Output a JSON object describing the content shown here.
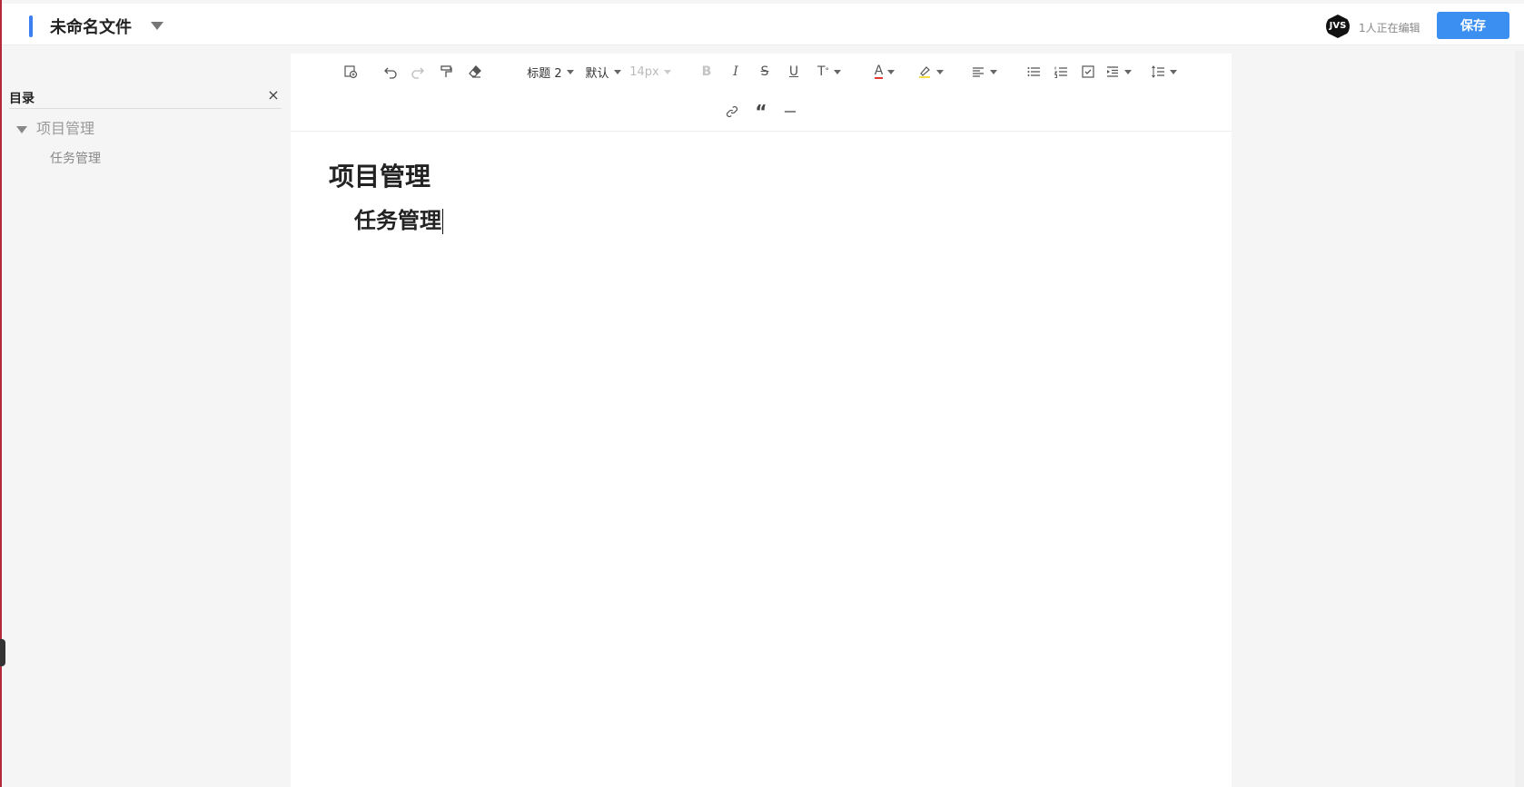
{
  "header": {
    "doc_title": "未命名文件",
    "avatar_text": "JVS",
    "editing_status": "1人正在编辑",
    "save_label": "保存"
  },
  "toc": {
    "title": "目录",
    "close_symbol": "×",
    "items": [
      {
        "label": "项目管理",
        "level": 1,
        "expanded": true
      },
      {
        "label": "任务管理",
        "level": 2
      }
    ]
  },
  "toolbar": {
    "heading_select": "标题 2",
    "font_select": "默认",
    "size_select": "14px",
    "icons": [
      "insert-template-icon",
      "undo-icon",
      "redo-icon",
      "format-painter-icon",
      "eraser-icon",
      "bold-icon",
      "italic-icon",
      "strikethrough-icon",
      "underline-icon",
      "text-style-icon",
      "font-color-icon",
      "highlight-icon",
      "align-icon",
      "bullet-list-icon",
      "ordered-list-icon",
      "task-list-icon",
      "indent-icon",
      "line-height-icon",
      "link-icon",
      "quote-icon",
      "divider-icon"
    ],
    "colors": {
      "font_color_bar": "#e53935",
      "highlight_bar": "#f5e04a"
    }
  },
  "content": {
    "heading1": "项目管理",
    "heading2": "任务管理"
  },
  "colors": {
    "accent": "#3b7ff0",
    "save_button": "#3b8ff0"
  }
}
